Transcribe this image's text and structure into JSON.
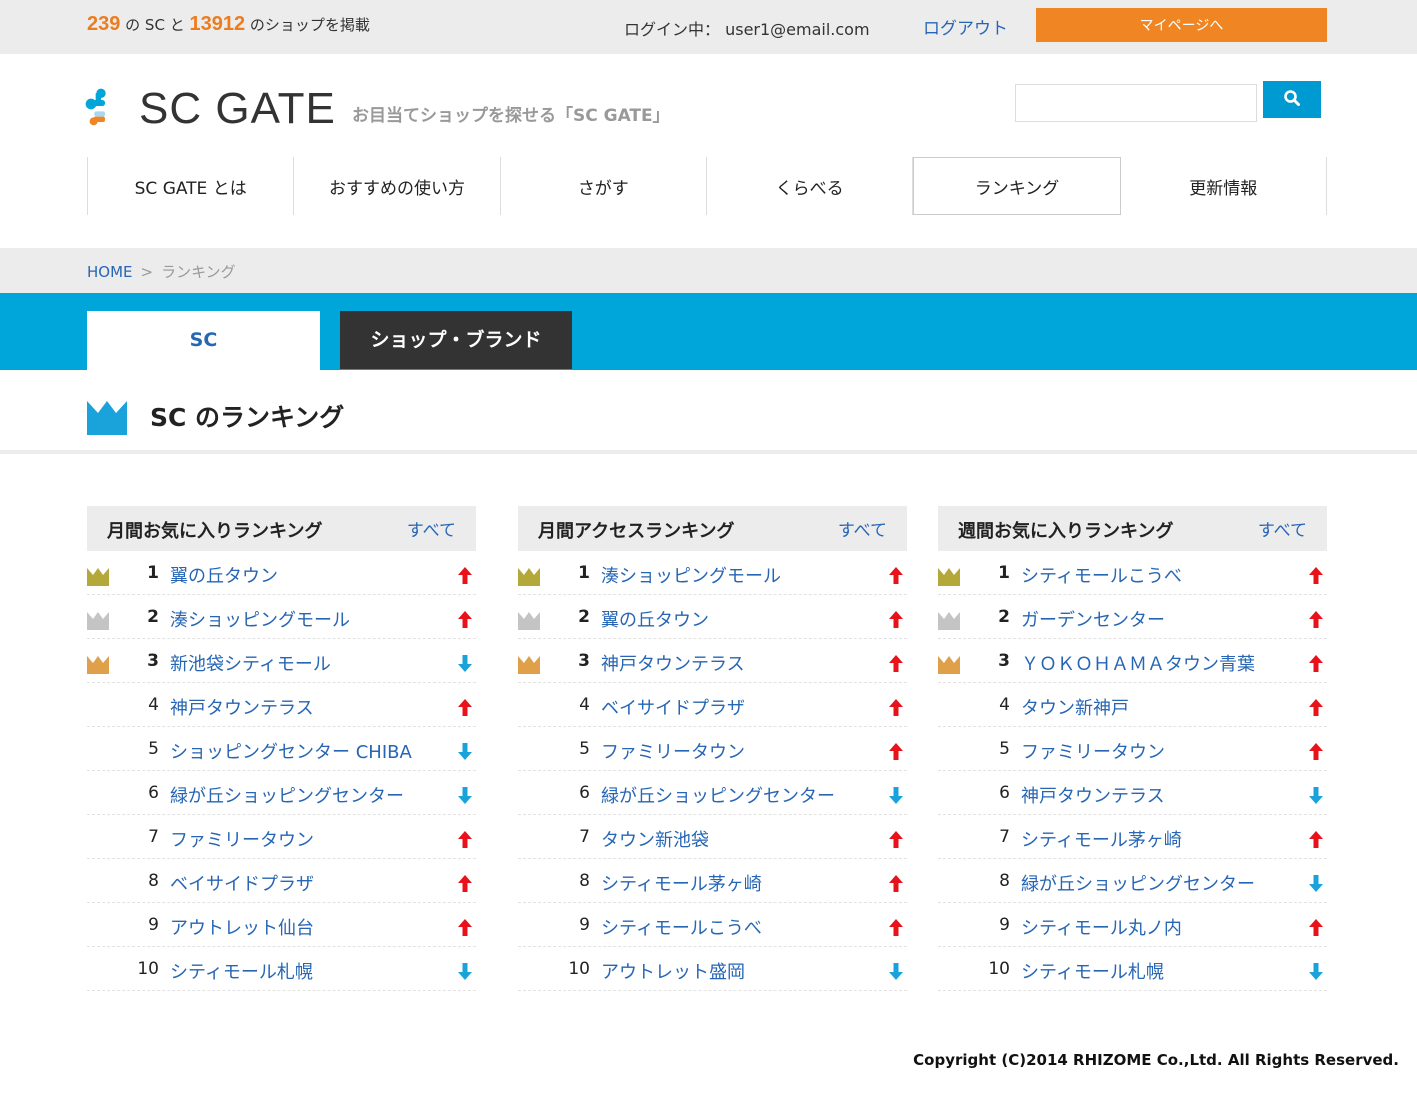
{
  "topbar": {
    "sc_count": "239",
    "sc_label": "の SC と",
    "shop_count": "13912",
    "shop_label": "のショップを掲載",
    "login_text": "ログイン中：  user1@email.com",
    "logout_label": "ログアウト",
    "mypage_label": "マイページへ"
  },
  "header": {
    "logo_text": "SC GATE",
    "tagline": "お目当てショップを探せる「SC GATE」",
    "search_placeholder": ""
  },
  "nav": [
    "SC GATE とは",
    "おすすめの使い方",
    "さがす",
    "くらべる",
    "ランキング",
    "更新情報"
  ],
  "breadcrumb": {
    "home": "HOME",
    "sep": ">",
    "current": "ランキング"
  },
  "tabs": {
    "sc": "SC",
    "shop": "ショップ・ブランド"
  },
  "page_title": "SC のランキング",
  "colors": {
    "accent_blue": "#00a5d9",
    "link": "#2766b4",
    "orange": "#f08523",
    "gold": "#b5a83a",
    "silver": "#c4c4c4",
    "bronze": "#e0a04a",
    "up": "#e8121b",
    "down": "#1aa3db"
  },
  "rankings": [
    {
      "title": "月間お気に入りランキング",
      "all_label": "すべて",
      "items": [
        {
          "rank": "1",
          "name": "翼の丘タウン",
          "trend": "up"
        },
        {
          "rank": "2",
          "name": "湊ショッピングモール",
          "trend": "up"
        },
        {
          "rank": "3",
          "name": "新池袋シティモール",
          "trend": "down"
        },
        {
          "rank": "4",
          "name": "神戸タウンテラス",
          "trend": "up"
        },
        {
          "rank": "5",
          "name": "ショッピングセンター CHIBA",
          "trend": "down"
        },
        {
          "rank": "6",
          "name": "緑が丘ショッピングセンター",
          "trend": "down"
        },
        {
          "rank": "7",
          "name": "ファミリータウン",
          "trend": "up"
        },
        {
          "rank": "8",
          "name": "ベイサイドプラザ",
          "trend": "up"
        },
        {
          "rank": "9",
          "name": "アウトレット仙台",
          "trend": "up"
        },
        {
          "rank": "10",
          "name": "シティモール札幌",
          "trend": "down"
        }
      ]
    },
    {
      "title": "月間アクセスランキング",
      "all_label": "すべて",
      "items": [
        {
          "rank": "1",
          "name": "湊ショッピングモール",
          "trend": "up"
        },
        {
          "rank": "2",
          "name": "翼の丘タウン",
          "trend": "up"
        },
        {
          "rank": "3",
          "name": "神戸タウンテラス",
          "trend": "up"
        },
        {
          "rank": "4",
          "name": "ベイサイドプラザ",
          "trend": "up"
        },
        {
          "rank": "5",
          "name": "ファミリータウン",
          "trend": "up"
        },
        {
          "rank": "6",
          "name": "緑が丘ショッピングセンター",
          "trend": "down"
        },
        {
          "rank": "7",
          "name": "タウン新池袋",
          "trend": "up"
        },
        {
          "rank": "8",
          "name": "シティモール茅ヶ崎",
          "trend": "up"
        },
        {
          "rank": "9",
          "name": "シティモールこうべ",
          "trend": "up"
        },
        {
          "rank": "10",
          "name": "アウトレット盛岡",
          "trend": "down"
        }
      ]
    },
    {
      "title": "週間お気に入りランキング",
      "all_label": "すべて",
      "items": [
        {
          "rank": "1",
          "name": "シティモールこうべ",
          "trend": "up"
        },
        {
          "rank": "2",
          "name": "ガーデンセンター",
          "trend": "up"
        },
        {
          "rank": "3",
          "name": "ＹＯＫＯＨＡＭＡタウン青葉",
          "trend": "up"
        },
        {
          "rank": "4",
          "name": "タウン新神戸",
          "trend": "up"
        },
        {
          "rank": "5",
          "name": "ファミリータウン",
          "trend": "up"
        },
        {
          "rank": "6",
          "name": "神戸タウンテラス",
          "trend": "down"
        },
        {
          "rank": "7",
          "name": "シティモール茅ヶ崎",
          "trend": "up"
        },
        {
          "rank": "8",
          "name": "緑が丘ショッピングセンター",
          "trend": "down"
        },
        {
          "rank": "9",
          "name": "シティモール丸ノ内",
          "trend": "up"
        },
        {
          "rank": "10",
          "name": "シティモール札幌",
          "trend": "down"
        }
      ]
    }
  ],
  "footer": "Copyright (C)2014 RHIZOME Co.,Ltd. All Rights Reserved."
}
